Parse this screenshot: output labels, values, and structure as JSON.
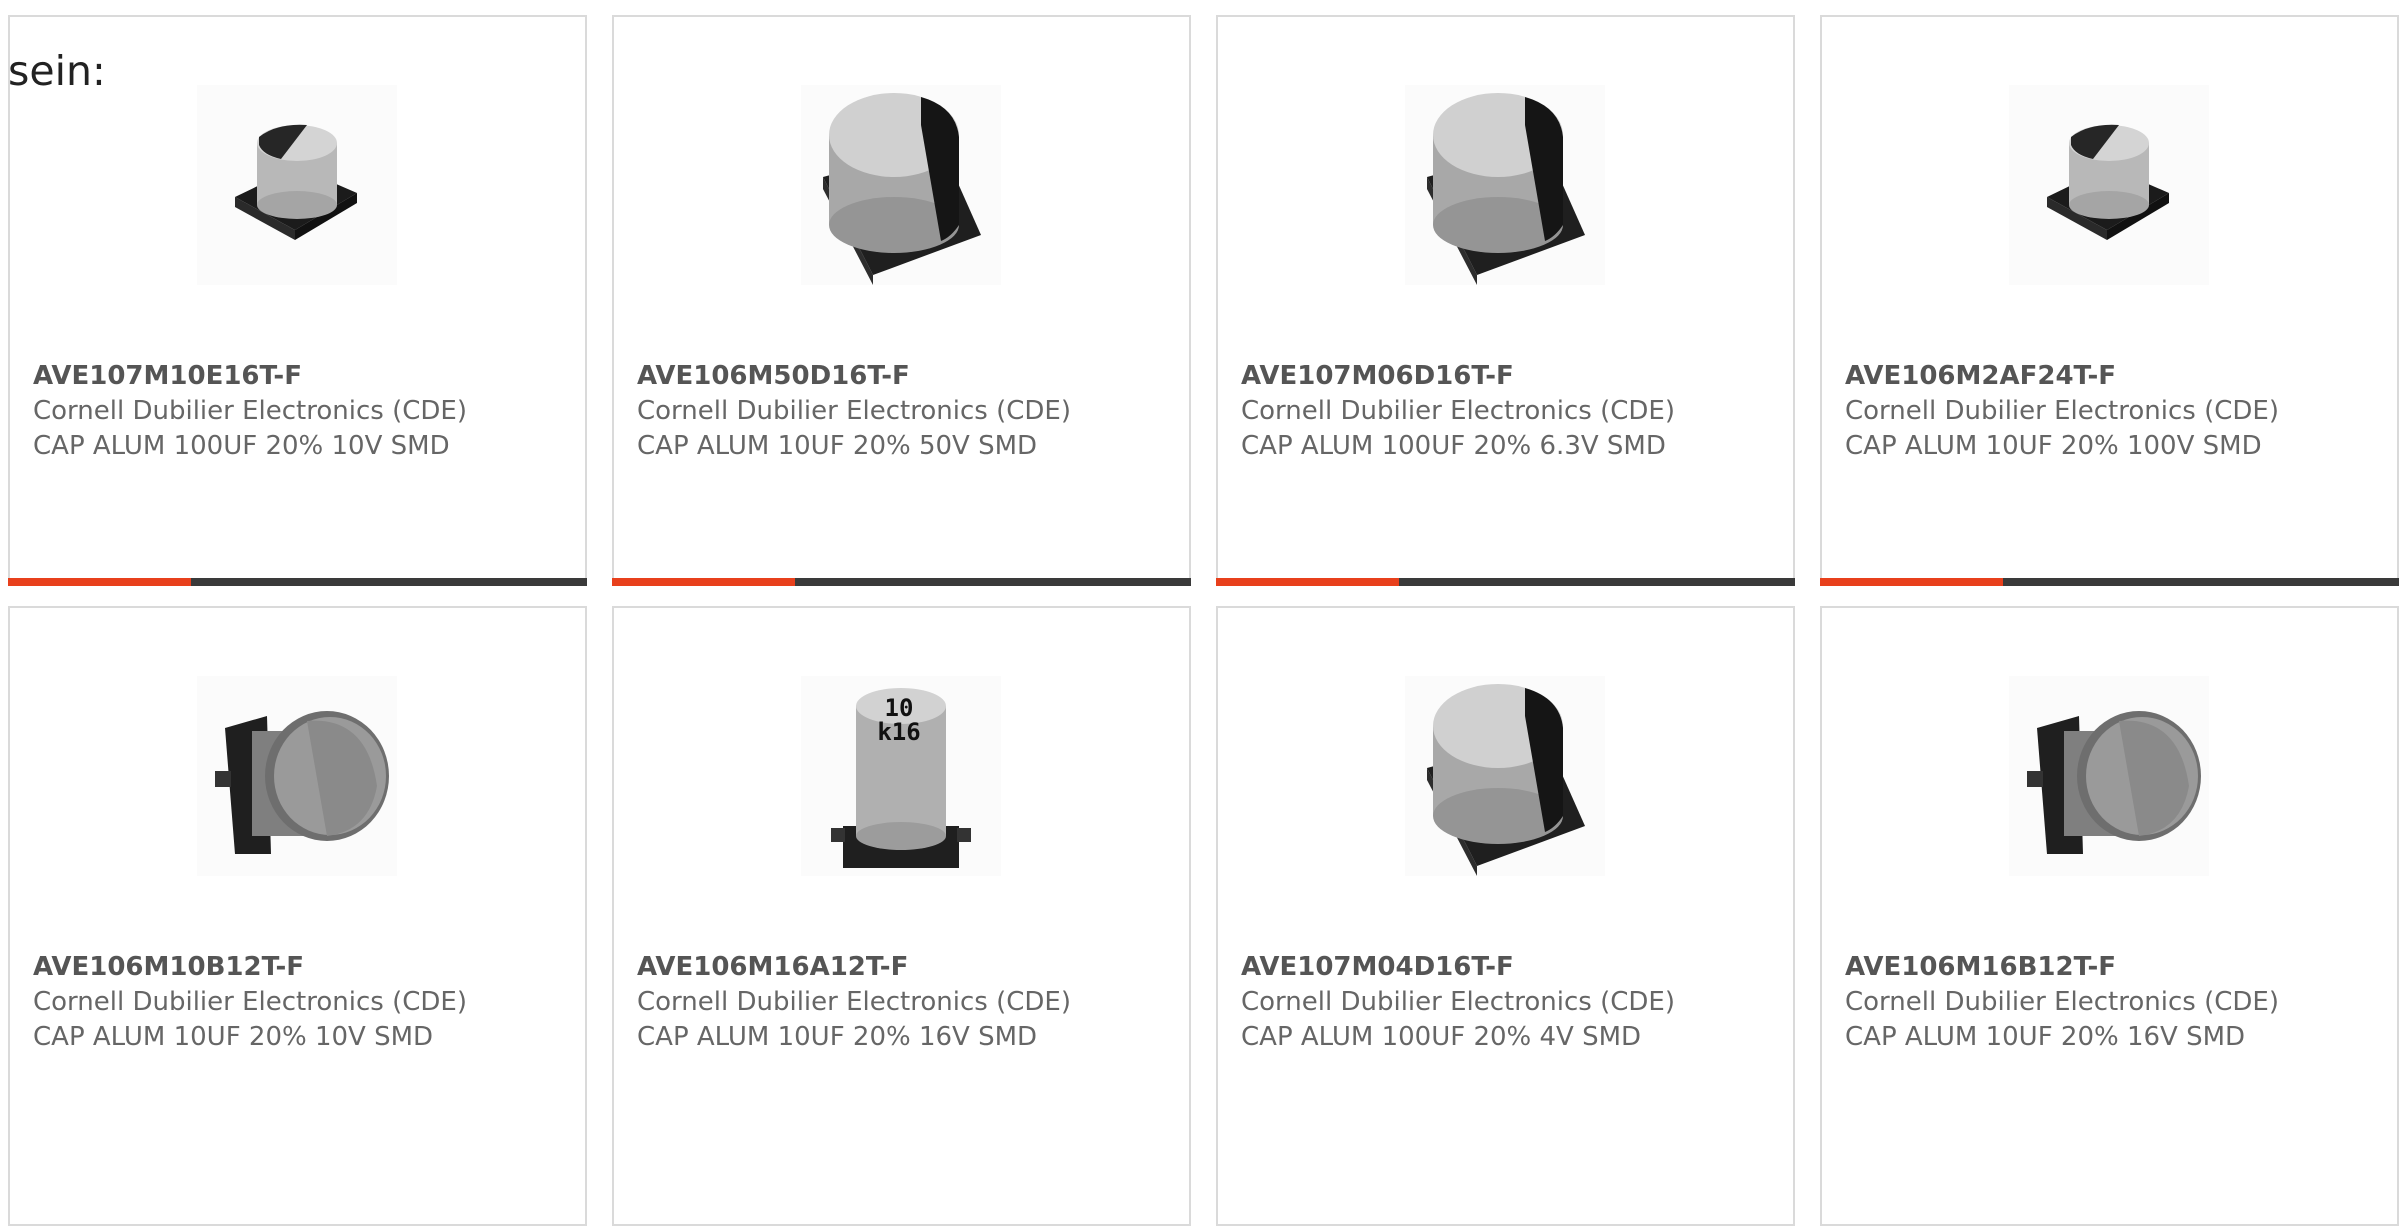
{
  "intro_text": "sein:",
  "colors": {
    "accent": "#e8401c",
    "bar": "#3a3a3a",
    "border": "#dadada",
    "text": "#555555"
  },
  "products": [
    {
      "part_number": "AVE107M10E16T-F",
      "manufacturer": "Cornell Dubilier Electronics (CDE)",
      "description": "CAP ALUM 100UF 20% 10V SMD",
      "image_icon": "smd-capacitor-small-icon"
    },
    {
      "part_number": "AVE106M50D16T-F",
      "manufacturer": "Cornell Dubilier Electronics (CDE)",
      "description": "CAP ALUM 10UF 20% 50V SMD",
      "image_icon": "smd-capacitor-large-icon"
    },
    {
      "part_number": "AVE107M06D16T-F",
      "manufacturer": "Cornell Dubilier Electronics (CDE)",
      "description": "CAP ALUM 100UF 20% 6.3V SMD",
      "image_icon": "smd-capacitor-large-icon"
    },
    {
      "part_number": "AVE106M2AF24T-F",
      "manufacturer": "Cornell Dubilier Electronics (CDE)",
      "description": "CAP ALUM 10UF 20% 100V SMD",
      "image_icon": "smd-capacitor-small-icon"
    },
    {
      "part_number": "AVE106M10B12T-F",
      "manufacturer": "Cornell Dubilier Electronics (CDE)",
      "description": "CAP ALUM 10UF 20% 10V SMD",
      "image_icon": "smd-capacitor-side-icon"
    },
    {
      "part_number": "AVE106M16A12T-F",
      "manufacturer": "Cornell Dubilier Electronics (CDE)",
      "description": "CAP ALUM 10UF 20% 16V SMD",
      "image_icon": "smd-capacitor-marked-icon",
      "marking_line1": "10",
      "marking_line2": "k16"
    },
    {
      "part_number": "AVE107M04D16T-F",
      "manufacturer": "Cornell Dubilier Electronics (CDE)",
      "description": "CAP ALUM 100UF 20% 4V SMD",
      "image_icon": "smd-capacitor-large-icon"
    },
    {
      "part_number": "AVE106M16B12T-F",
      "manufacturer": "Cornell Dubilier Electronics (CDE)",
      "description": "CAP ALUM 10UF 20% 16V SMD",
      "image_icon": "smd-capacitor-side-icon"
    }
  ]
}
